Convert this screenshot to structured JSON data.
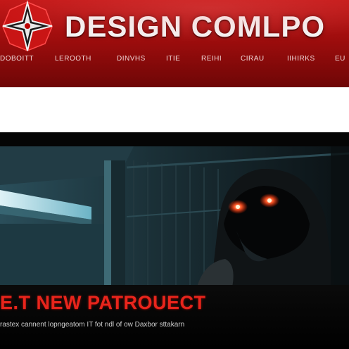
{
  "header": {
    "brand_title": "DESIGN COMLPO",
    "nav": [
      "DOBOITT",
      "LEROOTH",
      "DINVHS",
      "ITIE",
      "REIHI",
      "CIRAU",
      "IIHIRKS",
      "EU"
    ]
  },
  "hero": {
    "image": "hooded figure with glowing red eyes in dark corridor"
  },
  "promo": {
    "title": "E.T NEW PATROUECT",
    "text": "rastex cannent lopngeatom IT fot ndl of ow Daxbor sttakarn"
  },
  "colors": {
    "header_red": "#b31212",
    "promo_red": "#e8251c",
    "background": "#000000"
  }
}
